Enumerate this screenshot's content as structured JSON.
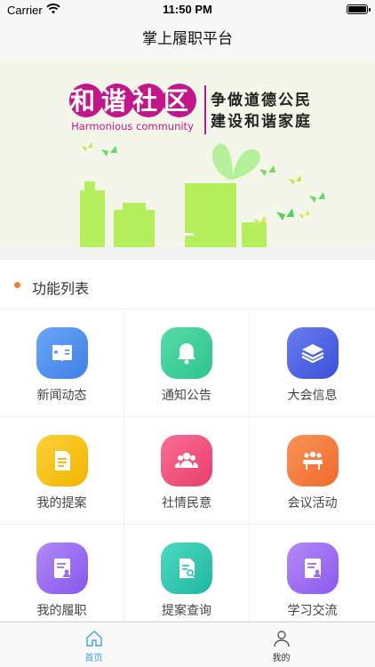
{
  "status_bar": {
    "carrier": "Carrier",
    "time": "11:50 PM"
  },
  "nav": {
    "title": "掌上履职平台"
  },
  "banner": {
    "badge_text": "和谐社区",
    "badge_subtitle": "Harmonious community",
    "slogan_line1": "争做道德公民",
    "slogan_line2": "建设和谐家庭"
  },
  "section": {
    "title": "功能列表"
  },
  "features": [
    {
      "label": "新闻动态",
      "icon": "newspaper-icon",
      "color": "#4f8ff0"
    },
    {
      "label": "通知公告",
      "icon": "bell-icon",
      "color": "#3fcf9a"
    },
    {
      "label": "大会信息",
      "icon": "layers-icon",
      "color": "#4a64e6"
    },
    {
      "label": "我的提案",
      "icon": "document-icon",
      "color": "#f5c11a"
    },
    {
      "label": "社情民意",
      "icon": "people-icon",
      "color": "#f2557d"
    },
    {
      "label": "会议活动",
      "icon": "meeting-icon",
      "color": "#f6803f"
    },
    {
      "label": "我的履职",
      "icon": "profile-card-icon",
      "color": "#9b6ef0"
    },
    {
      "label": "提案查询",
      "icon": "search-document-icon",
      "color": "#35c9b3"
    },
    {
      "label": "学习交流",
      "icon": "study-card-icon",
      "color": "#a06cf2"
    }
  ],
  "tabs": [
    {
      "label": "首页",
      "icon": "home-icon",
      "active": true
    },
    {
      "label": "我的",
      "icon": "person-icon",
      "active": false
    }
  ],
  "colors": {
    "accent": "#3ba4e8",
    "section_dot": "#ef7d30",
    "slogan_text": "#222222",
    "badge_fill": "#c2178b"
  }
}
